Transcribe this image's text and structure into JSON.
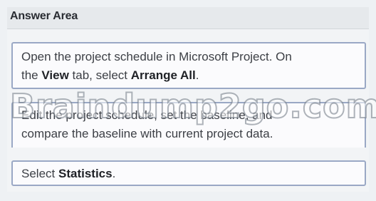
{
  "answer_area": {
    "title": "Answer Area"
  },
  "steps": [
    {
      "line1": "Open the project schedule in Microsoft Project. On",
      "line2_prefix": "the ",
      "line2_bold1": "View",
      "line2_mid": " tab, select ",
      "line2_bold2": "Arrange All",
      "line2_suffix": "."
    },
    {
      "line1": "Edit the project schedule, set the baseline, and",
      "line2": "compare the baseline with current project data."
    },
    {
      "prefix": "Select ",
      "bold": "Statistics",
      "suffix": "."
    }
  ],
  "watermark": {
    "text": "Braindump2go.com"
  }
}
